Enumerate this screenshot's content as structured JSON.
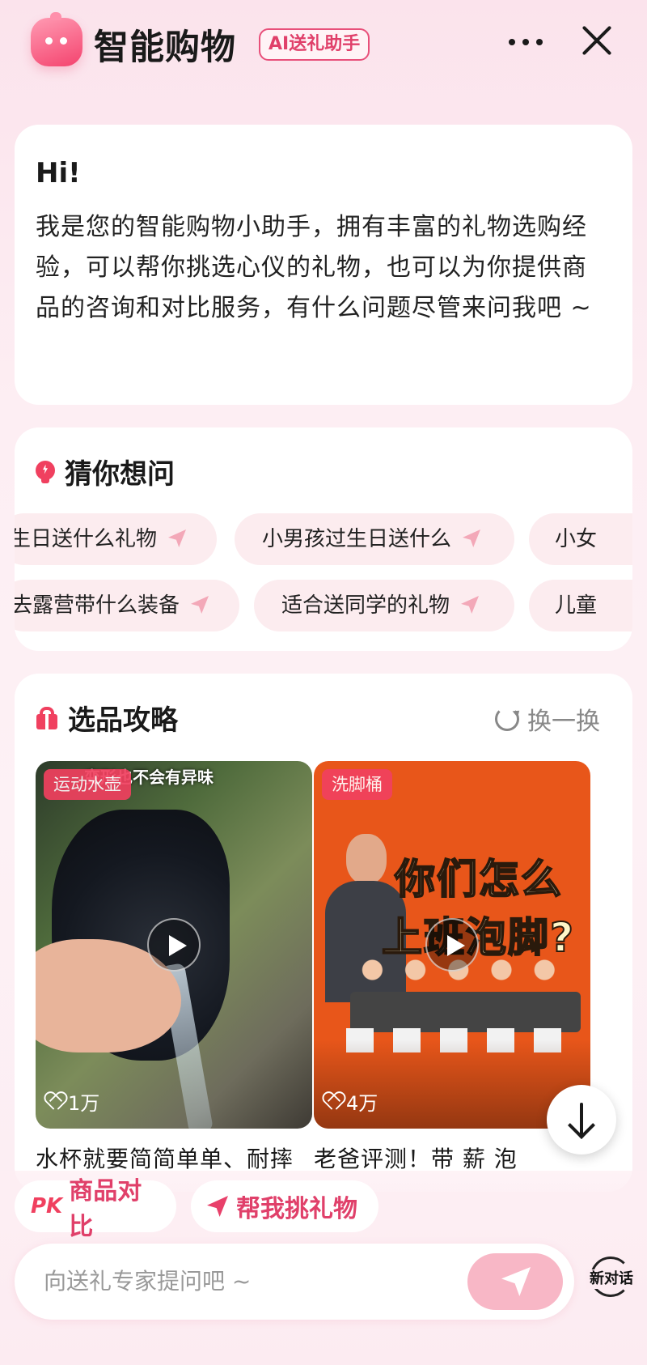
{
  "header": {
    "title": "智能购物",
    "badge": "AI送礼助手"
  },
  "greeting": {
    "hi": "Hi!",
    "intro": "我是您的智能购物小助手，拥有丰富的礼物选购经验，可以帮你挑选心仪的礼物，也可以为你提供商品的咨询和对比服务，有什么问题尽管来问我吧 ~"
  },
  "guess": {
    "title": "猜你想问",
    "row1": [
      "生日送什么礼物",
      "小男孩过生日送什么",
      "小女"
    ],
    "row2": [
      "去露营带什么装备",
      "适合送同学的礼物",
      "儿童"
    ]
  },
  "guide": {
    "title": "选品攻略",
    "swap_label": "换一换",
    "videos": [
      {
        "tag": "运动水壶",
        "caption": "变形也不会有异味",
        "likes": "1万",
        "title": "水杯就要简简单单、耐摔"
      },
      {
        "tag": "洗脚桶",
        "overlay_line1": "你们怎么",
        "overlay_line2": "上班泡脚?",
        "likes": "4万",
        "title": "老爸评测！带 薪 泡"
      }
    ]
  },
  "actions": {
    "pk_icon": "PK",
    "pk_label": "商品对比",
    "pick_label": "帮我挑礼物"
  },
  "input": {
    "placeholder": "向送礼专家提问吧 ~"
  },
  "new_chat_label": "新对话",
  "colors": {
    "accent": "#f0405f",
    "badge_text": "#e0406a",
    "chip_bg": "#fcecef",
    "send_btn": "#f8b7c6"
  }
}
